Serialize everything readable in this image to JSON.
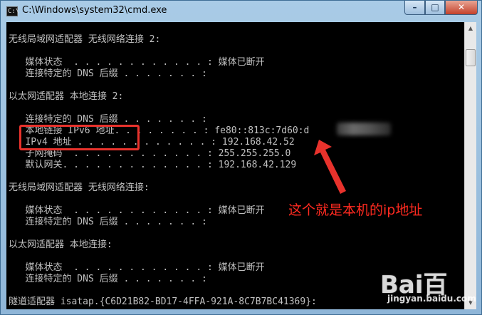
{
  "window": {
    "title": "C:\\Windows\\system32\\cmd.exe",
    "app_icon": "C:\\",
    "minimize_glyph": "–",
    "maximize_glyph": "□",
    "close_glyph": "✕"
  },
  "console": {
    "lines": [
      "无线局域网适配器 无线网络连接 2:",
      "",
      "   媒体状态  . . . . . . . . . . . . : 媒体已断开",
      "   连接特定的 DNS 后缀 . . . . . . . :",
      "",
      "以太网适配器 本地连接 2:",
      "",
      "   连接特定的 DNS 后缀 . . . . . . . :",
      "   本地链接 IPv6 地址. . . . . . . . : fe80::813c:7d60:d",
      "   IPv4 地址 . . . . . . . . . . . . : 192.168.42.52",
      "   子网掩码  . . . . . . . . . . . . : 255.255.255.0",
      "   默认网关. . . . . . . . . . . . . : 192.168.42.129",
      "",
      "无线局域网适配器 无线网络连接:",
      "",
      "   媒体状态  . . . . . . . . . . . . : 媒体已断开",
      "   连接特定的 DNS 后缀 . . . . . . . :",
      "",
      "以太网适配器 本地连接:",
      "",
      "   媒体状态  . . . . . . . . . . . . : 媒体已断开",
      "   连接特定的 DNS 后缀 . . . . . . . :",
      "",
      "隧道适配器 isatap.{C6D21B82-BD17-4FFA-921A-8C7B7BC41369}:"
    ]
  },
  "annotation": {
    "text": "这个就是本机的ip地址",
    "color": "#ff2a20"
  },
  "watermark": {
    "logo": "Bai百",
    "url": "jingyan.baidu.com"
  },
  "colors": {
    "console_bg": "#000000",
    "console_text": "#c0c0c0",
    "highlight": "#e8322c"
  }
}
